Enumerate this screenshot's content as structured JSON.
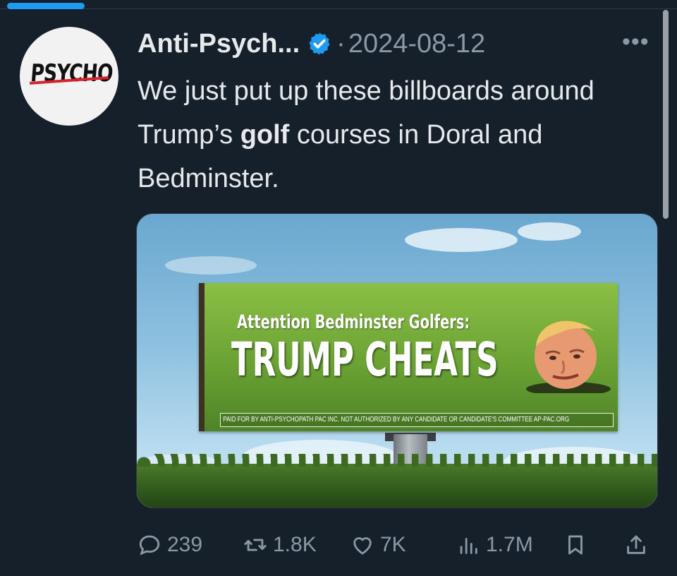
{
  "tweet": {
    "author_name": "Anti-Psych...",
    "separator": "·",
    "date": "2024-08-12",
    "more_label": "•••",
    "text_before": "We just put up these billboards around Trump’s ",
    "text_bold": "golf",
    "text_after": " courses in Doral and Bedminster."
  },
  "avatar": {
    "logo_text": "PSYCHO"
  },
  "media": {
    "billboard_attention": "Attention Bedminster Golfers:",
    "billboard_headline": "TRUMP CHEATS",
    "billboard_disclaimer": "PAID FOR BY ANTI-PSYCHOPATH PAC INC. NOT AUTHORIZED BY ANY CANDIDATE OR CANDIDATE'S COMMITTEE AP-PAC.ORG"
  },
  "actions": {
    "replies": "239",
    "reposts": "1.8K",
    "likes": "7K",
    "views": "1.7M"
  },
  "colors": {
    "background": "#15202b",
    "accent": "#1d9bf0",
    "muted": "#8b98a5",
    "text": "#e7e9ea"
  },
  "icons": [
    "verified-badge-icon",
    "more-options-icon",
    "reply-icon",
    "repost-icon",
    "like-icon",
    "views-icon",
    "bookmark-icon",
    "share-icon"
  ]
}
